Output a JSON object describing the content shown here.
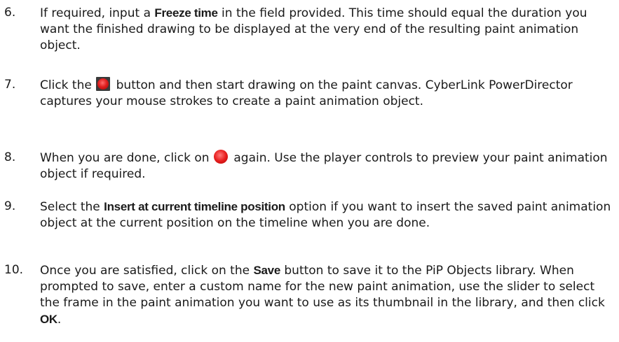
{
  "steps": [
    {
      "number": "6.",
      "parts": {
        "a": "If required, input a ",
        "b": "Freeze time",
        "c": " in the field provided. This time should equal the duration you want the finished drawing to be displayed at the very end of the resulting paint animation object."
      }
    },
    {
      "number": "7.",
      "parts": {
        "a": "Click the ",
        "icon": "record-button-icon",
        "c": " button and then start drawing on the paint canvas. CyberLink PowerDirector captures your mouse strokes to create a paint animation object."
      }
    },
    {
      "number": "8.",
      "parts": {
        "a": "When you are done, click on ",
        "icon": "stop-record-button-icon",
        "c": " again. Use the player controls to preview your paint animation object if required."
      }
    },
    {
      "number": "9.",
      "parts": {
        "a": "Select the ",
        "b": "Insert at current timeline position",
        "c": " option if you want to insert the saved paint animation object at the current position on the timeline when you are done."
      }
    },
    {
      "number": "10.",
      "parts": {
        "a": "Once you are satisfied, click on the ",
        "b": "Save",
        "c": " button to save it to the PiP Objects library. When prompted to save, enter a custom name for the new paint animation, use the slider to select the frame in the paint animation you want to use as its thumbnail in the library, and then click ",
        "d": "OK",
        "e": "."
      }
    }
  ],
  "colors": {
    "text": "#1a1a1a",
    "record_red": "#e02020"
  }
}
